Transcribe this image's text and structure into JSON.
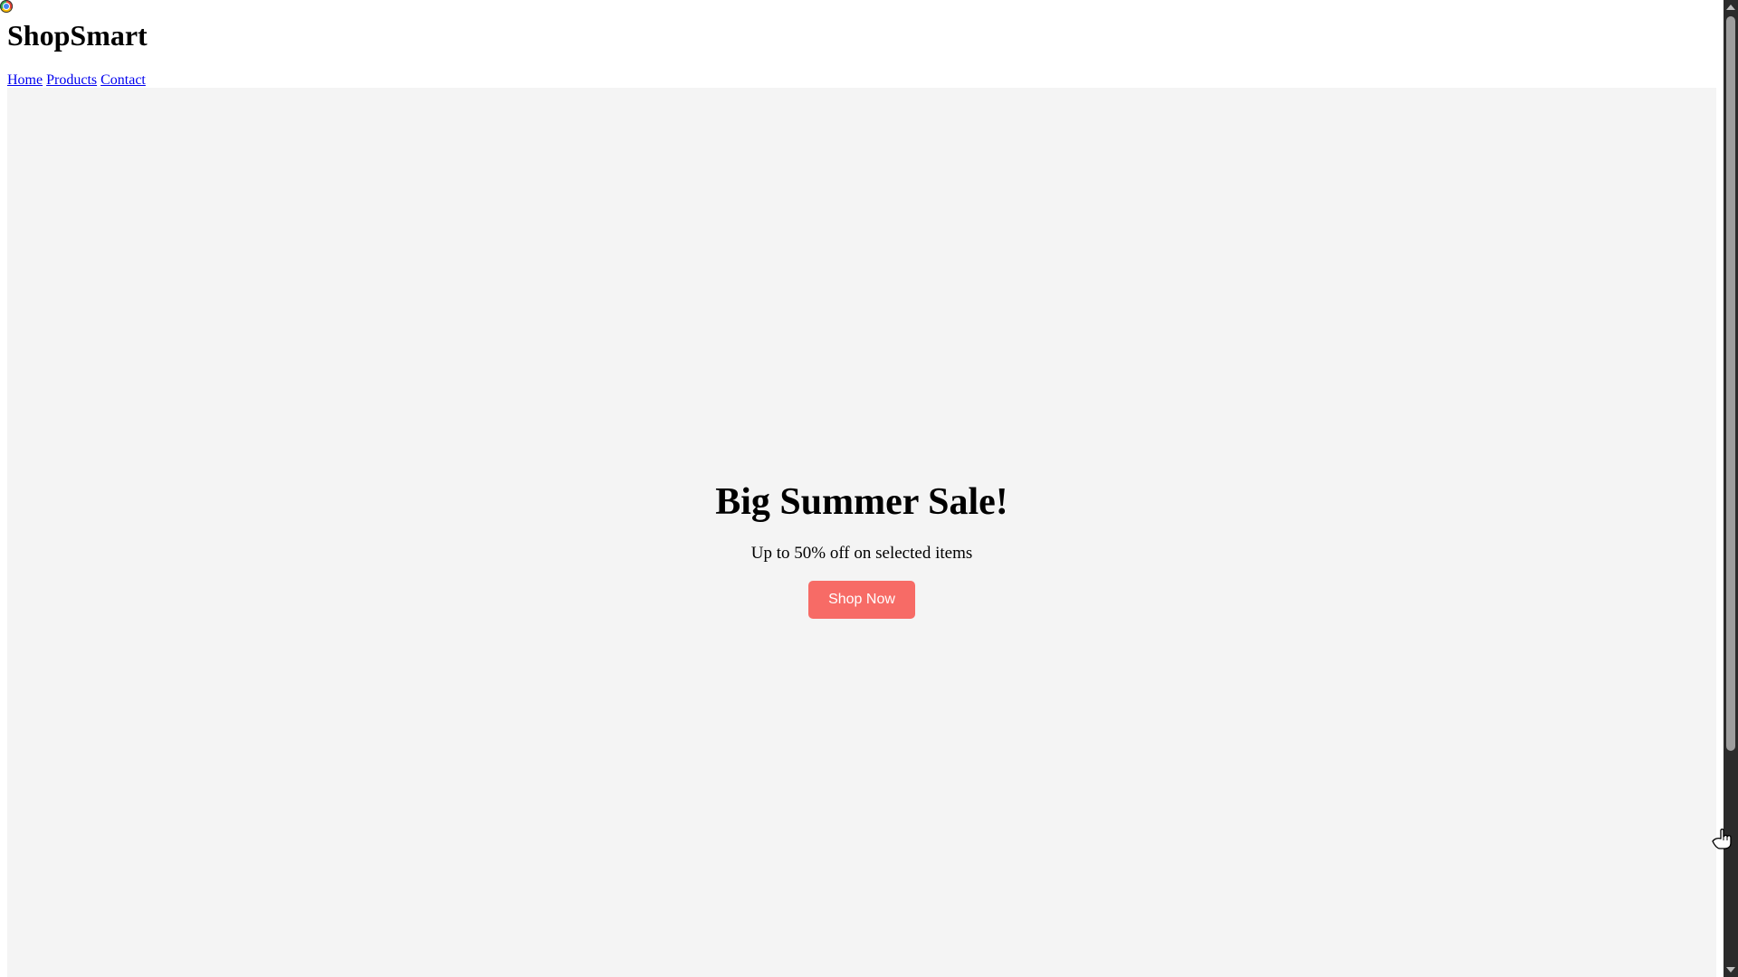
{
  "app": {
    "icon": "chrome-icon"
  },
  "header": {
    "title": "ShopSmart",
    "nav": [
      {
        "label": "Home"
      },
      {
        "label": "Products"
      },
      {
        "label": "Contact"
      }
    ]
  },
  "hero": {
    "title": "Big Summer Sale!",
    "subtitle": "Up to 50% off on selected items",
    "cta_label": "Shop Now",
    "background_color": "#f4f4f4",
    "cta_color": "#f76b66"
  },
  "scrollbar": {
    "icon_up": "scroll-up-arrow-icon",
    "icon_down": "scroll-down-arrow-icon"
  },
  "cursor": {
    "icon": "hand-cursor-icon"
  }
}
